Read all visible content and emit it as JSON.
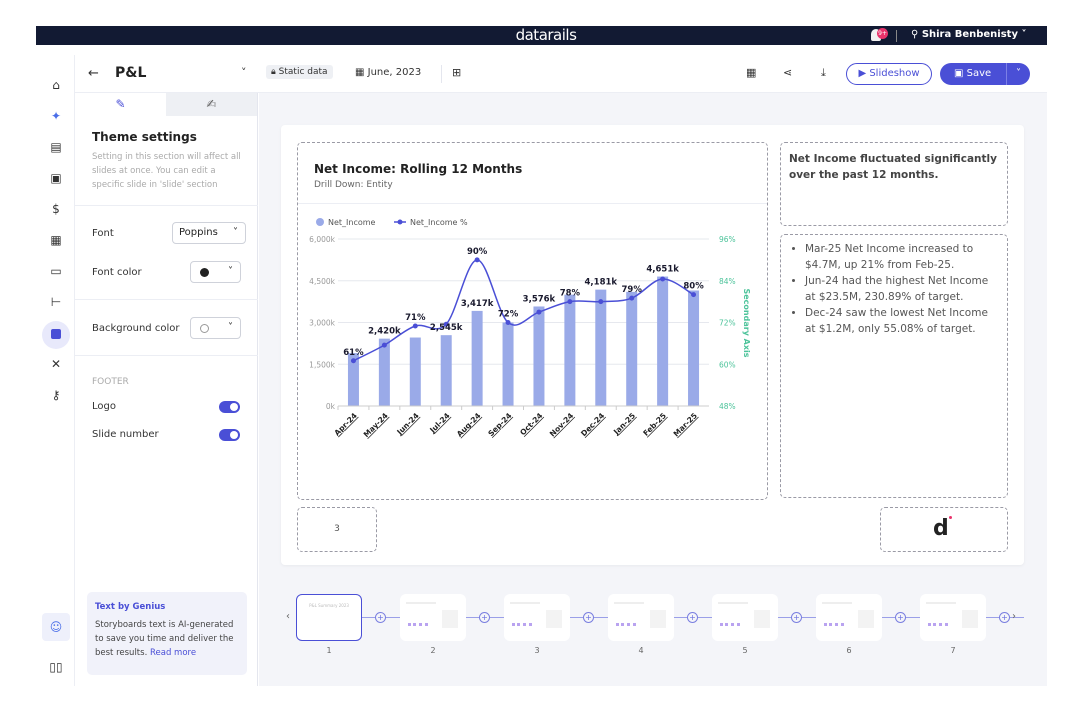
{
  "topbar": {
    "logo": "datarails",
    "notification_badge": "9+",
    "user_name": "Shira Benbenisty"
  },
  "toolbar": {
    "title": "P&L",
    "static_label": "Static data",
    "date": "June, 2023",
    "slideshow_label": "Slideshow",
    "save_label": "Save"
  },
  "panel": {
    "tabs": [
      {
        "icon": "brush-icon",
        "active": true
      },
      {
        "icon": "edit-icon",
        "active": false
      }
    ],
    "heading": "Theme settings",
    "description": "Setting in this section will affect all slides at once. You can edit a specific slide in 'slide' section",
    "font_label": "Font",
    "font_value": "Poppins",
    "font_color_label": "Font color",
    "font_color": "#222222",
    "bg_color_label": "Background color",
    "bg_color": "#ffffff",
    "footer_label": "FOOTER",
    "logo_label": "Logo",
    "logo_on": true,
    "slide_number_label": "Slide number",
    "slide_number_on": true,
    "genius": {
      "title": "Text by Genius",
      "body": "Storyboards text is AI-generated to save you time and deliver the best results.",
      "link": "Read more"
    }
  },
  "slide": {
    "summary_title": "Net Income fluctuated significantly over the past 12 months.",
    "bullets": [
      "Mar-25 Net Income increased to $4.7M, up 21% from Feb-25.",
      "Jun-24 had the highest Net Income at $23.5M, 230.89% of target.",
      "Dec-24 saw the lowest Net Income at $1.2M, only 55.08% of target."
    ],
    "slide_number": "3"
  },
  "chart_data": {
    "type": "bar",
    "title": "Net Income: Rolling 12 Months",
    "subtitle": "Drill Down: Entity",
    "categories": [
      "Apr-24",
      "May-24",
      "Jun-24",
      "Jul-24",
      "Aug-24",
      "Sep-24",
      "Oct-24",
      "Nov-24",
      "Dec-24",
      "Jan-25",
      "Feb-25",
      "Mar-25"
    ],
    "series": [
      {
        "name": "Net_Income",
        "type": "bar",
        "axis": "left",
        "color": "#9aaae8",
        "values": [
          1900,
          2420,
          2460,
          2545,
          3417,
          3000,
          3576,
          4000,
          4181,
          4100,
          4651,
          4150
        ],
        "labels": [
          null,
          "2,420k",
          null,
          "2,545k",
          "3,417k",
          null,
          "3,576k",
          null,
          "4,181k",
          null,
          "4,651k",
          null
        ]
      },
      {
        "name": "Net_Income %",
        "type": "line",
        "axis": "right",
        "color": "#4a4fd6",
        "values": [
          61,
          65.5,
          71,
          71.5,
          90,
          72,
          75,
          78,
          78,
          79,
          84.5,
          80
        ],
        "labels": [
          "61%",
          null,
          "71%",
          null,
          "90%",
          "72%",
          null,
          "78%",
          null,
          "79%",
          null,
          "80%"
        ]
      }
    ],
    "ylim": [
      0,
      6000
    ],
    "yticks": [
      "0k",
      "1,500k",
      "3,000k",
      "4,500k",
      "6,000k"
    ],
    "y2lim": [
      48,
      96
    ],
    "y2ticks": [
      "48%",
      "60%",
      "72%",
      "84%",
      "96%"
    ],
    "y2label": "Secondary Axis",
    "y2color": "#4cc39a",
    "grid": true,
    "legend": "top-left"
  },
  "thumbnails": [
    {
      "num": "1",
      "title": "P&L Summary 2023",
      "selected": true
    },
    {
      "num": "2"
    },
    {
      "num": "3"
    },
    {
      "num": "4"
    },
    {
      "num": "5"
    },
    {
      "num": "6"
    },
    {
      "num": "7"
    }
  ],
  "colors": {
    "accent": "#4a4fd6",
    "topbar": "#121a33"
  }
}
